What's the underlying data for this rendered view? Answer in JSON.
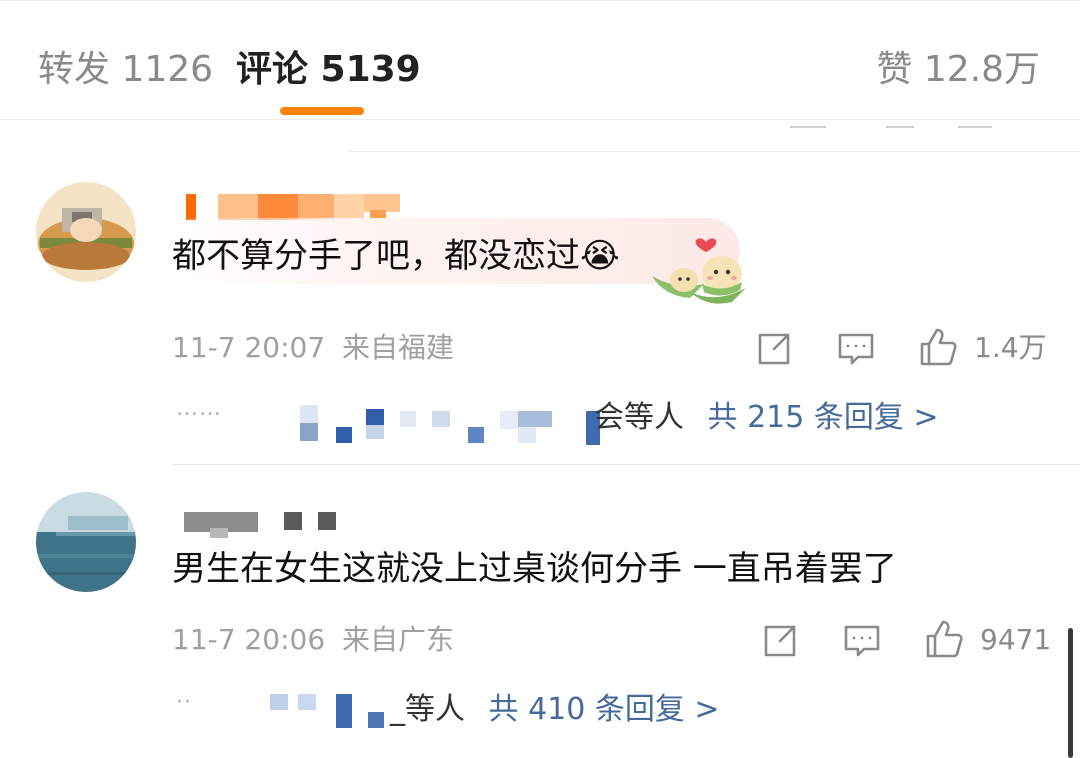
{
  "tabs": {
    "repost": "转发 1126",
    "comment": "评论 5139",
    "like": "赞 12.8万"
  },
  "colors": {
    "accent": "#ff8200",
    "link": "#466a9a",
    "muted": "#a0a0a0"
  },
  "comments": [
    {
      "text": "都不算分手了吧，都没恋过",
      "emoji": "😭",
      "time": "11-7 20:07",
      "location": "来自福建",
      "likes": "1.4万",
      "reply_people_suffix": "会等人",
      "reply_count_label": "共 215 条回复 >",
      "reply_dots": "……",
      "icons": [
        "share-icon",
        "comment-icon",
        "like-icon"
      ]
    },
    {
      "text": "男生在女生这就没上过桌谈何分手 一直吊着罢了",
      "time": "11-7 20:06",
      "location": "来自广东",
      "likes": "9471",
      "reply_people_suffix": "_等人",
      "reply_count_label": "共 410 条回复 >",
      "reply_dots": "··",
      "icons": [
        "share-icon",
        "comment-icon",
        "like-icon"
      ]
    }
  ]
}
